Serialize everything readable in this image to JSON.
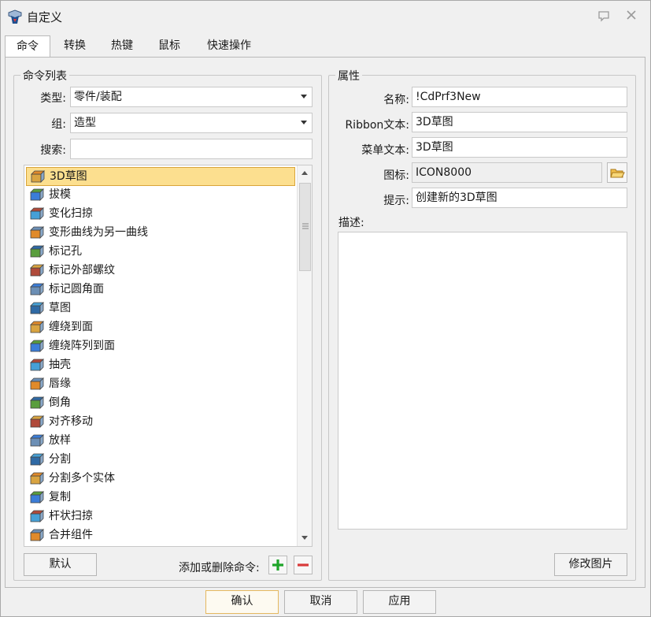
{
  "window": {
    "title": "自定义"
  },
  "tabs": [
    {
      "label": "命令"
    },
    {
      "label": "转换"
    },
    {
      "label": "热键"
    },
    {
      "label": "鼠标"
    },
    {
      "label": "快速操作"
    }
  ],
  "command_list": {
    "group_title": "命令列表",
    "type_label": "类型:",
    "type_value": "零件/装配",
    "group_label": "组:",
    "group_value": "造型",
    "search_label": "搜索:",
    "search_value": "",
    "items": [
      {
        "label": "3D草图",
        "icon": "sketch3d-icon"
      },
      {
        "label": "拔模",
        "icon": "draft-icon"
      },
      {
        "label": "变化扫掠",
        "icon": "variable-sweep-icon"
      },
      {
        "label": "变形曲线为另一曲线",
        "icon": "curve-deform-icon"
      },
      {
        "label": "标记孔",
        "icon": "hole-mark-icon"
      },
      {
        "label": "标记外部螺纹",
        "icon": "thread-mark-icon"
      },
      {
        "label": "标记圆角面",
        "icon": "fillet-mark-icon"
      },
      {
        "label": "草图",
        "icon": "sketch-icon"
      },
      {
        "label": "缠绕到面",
        "icon": "wrap-face-icon"
      },
      {
        "label": "缠绕阵列到面",
        "icon": "wrap-pattern-icon"
      },
      {
        "label": "抽壳",
        "icon": "shell-icon"
      },
      {
        "label": "唇缘",
        "icon": "lip-icon"
      },
      {
        "label": "倒角",
        "icon": "chamfer-icon"
      },
      {
        "label": "对齐移动",
        "icon": "align-move-icon"
      },
      {
        "label": "放样",
        "icon": "loft-icon"
      },
      {
        "label": "分割",
        "icon": "split-icon"
      },
      {
        "label": "分割多个实体",
        "icon": "split-multi-icon"
      },
      {
        "label": "复制",
        "icon": "copy-icon"
      },
      {
        "label": "杆状扫掠",
        "icon": "rod-sweep-icon"
      },
      {
        "label": "合并组件",
        "icon": "merge-component-icon"
      }
    ],
    "default_button": "默认",
    "add_remove_label": "添加或删除命令:"
  },
  "properties": {
    "group_title": "属性",
    "name_label": "名称:",
    "name_value": "!CdPrf3New",
    "ribbon_label": "Ribbon文本:",
    "ribbon_value": "3D草图",
    "menu_label": "菜单文本:",
    "menu_value": "3D草图",
    "icon_label": "图标:",
    "icon_value": "ICON8000",
    "tip_label": "提示:",
    "tip_value": "创建新的3D草图",
    "desc_label": "描述:",
    "change_image_button": "修改图片"
  },
  "footer": {
    "ok": "确认",
    "cancel": "取消",
    "apply": "应用"
  }
}
